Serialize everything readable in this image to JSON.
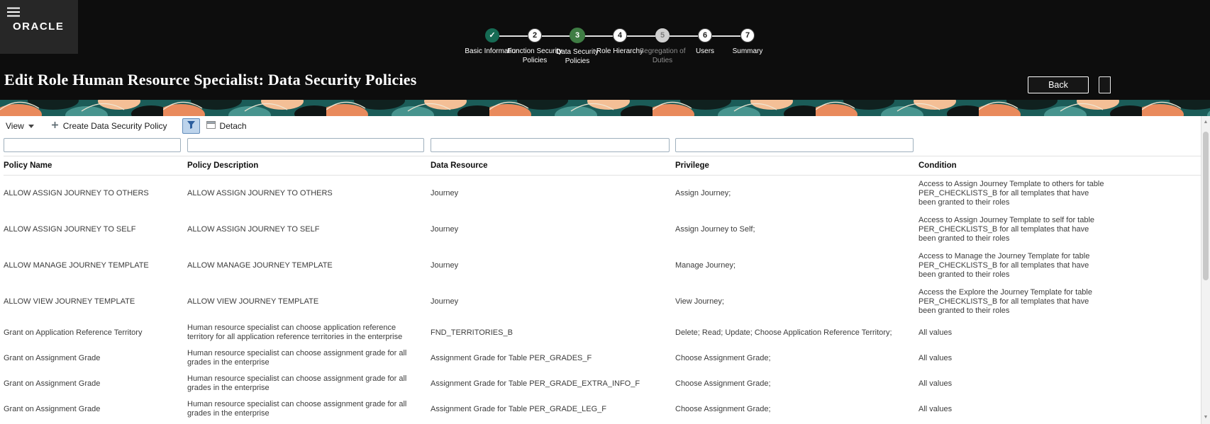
{
  "header": {
    "logo": "ORACLE",
    "title": "Edit Role Human Resource Specialist: Data Security Policies",
    "back_button": "Back"
  },
  "train": {
    "steps": [
      {
        "label": "Basic Information",
        "icon": "✓",
        "state": "completed"
      },
      {
        "label": "Function Security Policies",
        "number": "2",
        "state": "visited"
      },
      {
        "label": "Data Security Policies",
        "number": "3",
        "state": "current"
      },
      {
        "label": "Role Hierarchy",
        "number": "4",
        "state": "available"
      },
      {
        "label": "Segregation of Duties",
        "number": "5",
        "state": "disabled"
      },
      {
        "label": "Users",
        "number": "6",
        "state": "available"
      },
      {
        "label": "Summary",
        "number": "7",
        "state": "available"
      }
    ]
  },
  "toolbar": {
    "view_label": "View",
    "create_label": "Create Data Security Policy",
    "detach_label": "Detach"
  },
  "filters": {
    "policy_name": "",
    "policy_description": "",
    "data_resource": "",
    "privilege": ""
  },
  "table": {
    "columns": [
      "Policy Name",
      "Policy Description",
      "Data Resource",
      "Privilege",
      "Condition"
    ],
    "rows": [
      {
        "policy_name": "ALLOW ASSIGN JOURNEY TO OTHERS",
        "policy_description": "ALLOW ASSIGN JOURNEY TO OTHERS",
        "data_resource": "Journey",
        "privilege": "Assign Journey;",
        "condition": "Access to Assign Journey Template to others for table PER_CHECKLISTS_B for all templates that have been granted to their roles"
      },
      {
        "policy_name": "ALLOW ASSIGN JOURNEY TO SELF",
        "policy_description": "ALLOW ASSIGN JOURNEY TO SELF",
        "data_resource": "Journey",
        "privilege": "Assign Journey to Self;",
        "condition": "Access to Assign Journey Template to self for table PER_CHECKLISTS_B for all templates that have been granted to their roles"
      },
      {
        "policy_name": "ALLOW MANAGE JOURNEY TEMPLATE",
        "policy_description": "ALLOW MANAGE JOURNEY TEMPLATE",
        "data_resource": "Journey",
        "privilege": "Manage Journey;",
        "condition": "Access to Manage the Journey Template for table PER_CHECKLISTS_B for all templates that have been granted to their roles"
      },
      {
        "policy_name": "ALLOW VIEW JOURNEY TEMPLATE",
        "policy_description": "ALLOW VIEW JOURNEY TEMPLATE",
        "data_resource": "Journey",
        "privilege": "View Journey;",
        "condition": "Access the Explore the Journey Template for table PER_CHECKLISTS_B for all templates that have been granted to their roles"
      },
      {
        "policy_name": "Grant on Application Reference Territory",
        "policy_description": "Human resource specialist can choose application reference territory for all application reference territories in the enterprise",
        "data_resource": "FND_TERRITORIES_B",
        "privilege": "Delete; Read; Update; Choose Application Reference Territory;",
        "condition": "All values"
      },
      {
        "policy_name": "Grant on Assignment Grade",
        "policy_description": "Human resource specialist can choose assignment grade for all grades in the enterprise",
        "data_resource": "Assignment Grade for Table PER_GRADES_F",
        "privilege": "Choose Assignment Grade;",
        "condition": "All values"
      },
      {
        "policy_name": "Grant on Assignment Grade",
        "policy_description": "Human resource specialist can choose assignment grade for all grades in the enterprise",
        "data_resource": "Assignment Grade for Table PER_GRADE_EXTRA_INFO_F",
        "privilege": "Choose Assignment Grade;",
        "condition": "All values"
      },
      {
        "policy_name": "Grant on Assignment Grade",
        "policy_description": "Human resource specialist can choose assignment grade for all grades in the enterprise",
        "data_resource": "Assignment Grade for Table PER_GRADE_LEG_F",
        "privilege": "Choose Assignment Grade;",
        "condition": "All values"
      }
    ]
  },
  "colors": {
    "header_background": "#0d0d0d",
    "step_current": "#3f7d44",
    "step_completed": "#166b54",
    "banner_teal": "#1b5c58",
    "banner_orange": "#e98a5c",
    "qbe_active_background": "#bdd4ec"
  }
}
